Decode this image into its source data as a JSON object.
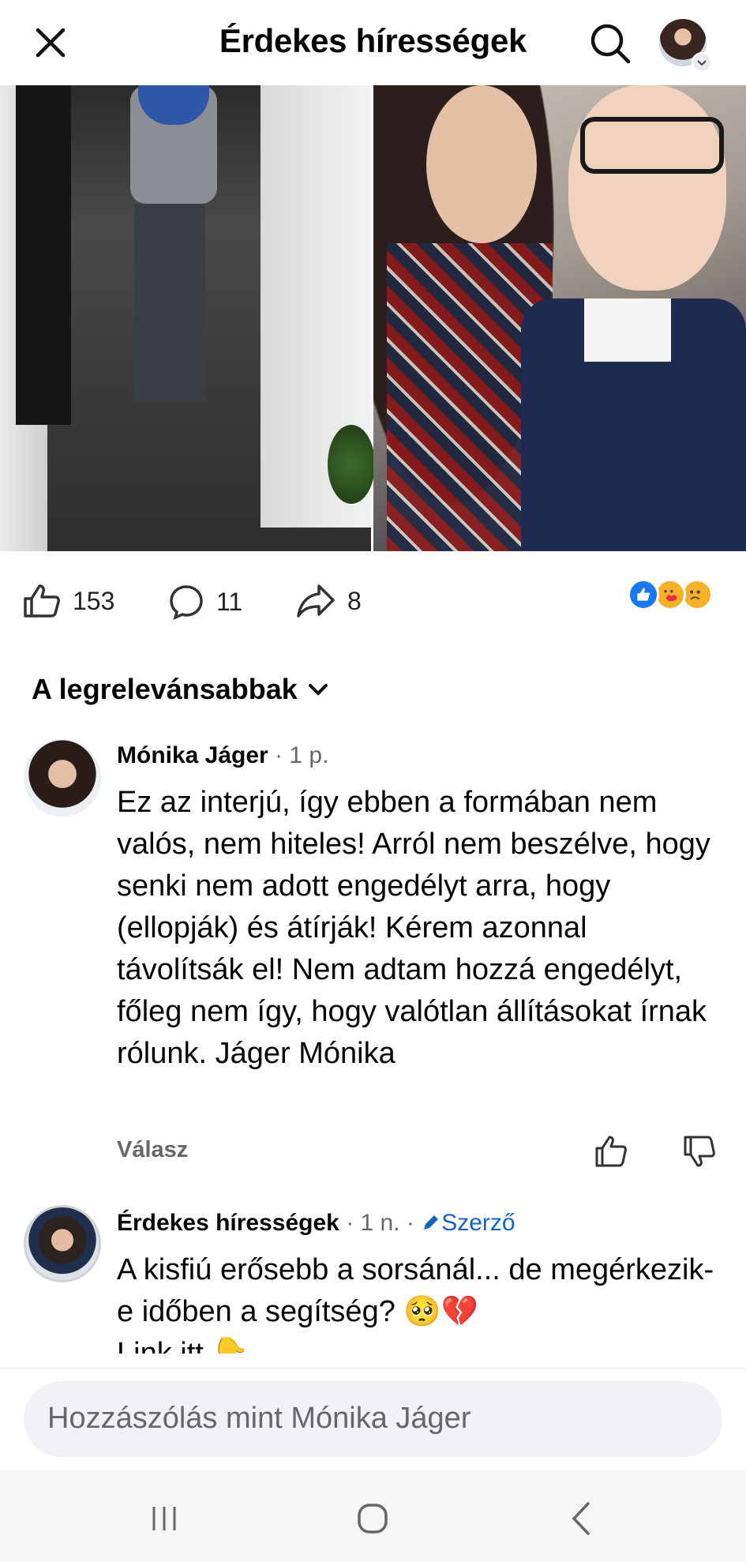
{
  "header": {
    "title": "Érdekes hírességek",
    "close_icon": "close-icon",
    "search_icon": "search-icon"
  },
  "post_stats": {
    "likes": "153",
    "comments": "11",
    "shares": "8",
    "reactions": [
      "like",
      "care",
      "sad"
    ]
  },
  "comments_section": {
    "sort_label": "A legrelevánsabbak"
  },
  "comments": [
    {
      "name": "Mónika Jáger",
      "meta": " · 1 p.",
      "text": "Ez az interjú, így ebben a formában nem valós, nem hiteles! Arról nem beszélve, hogy senki nem adott engedélyt arra, hogy (ellopják) és átírják! Kérem azonnal távolítsák el! Nem adtam hozzá engedélyt, főleg nem így, hogy valótlan állításokat írnak rólunk. Jáger Mónika",
      "reply_label": "Válasz"
    },
    {
      "name": "Érdekes hírességek",
      "meta": " · 1 n. · ",
      "author_badge": "Szerző",
      "text_line1": "A kisfiú erősebb a sorsánál... de megérkezik-e időben a segítség? 🥺💔",
      "text_line2": "Link itt 👇"
    }
  ],
  "composer": {
    "placeholder": "Hozzászólás mint Mónika Jáger"
  },
  "colors": {
    "accent": "#1877f2",
    "author_blue": "#1565c0",
    "meta_gray": "#65676b"
  }
}
